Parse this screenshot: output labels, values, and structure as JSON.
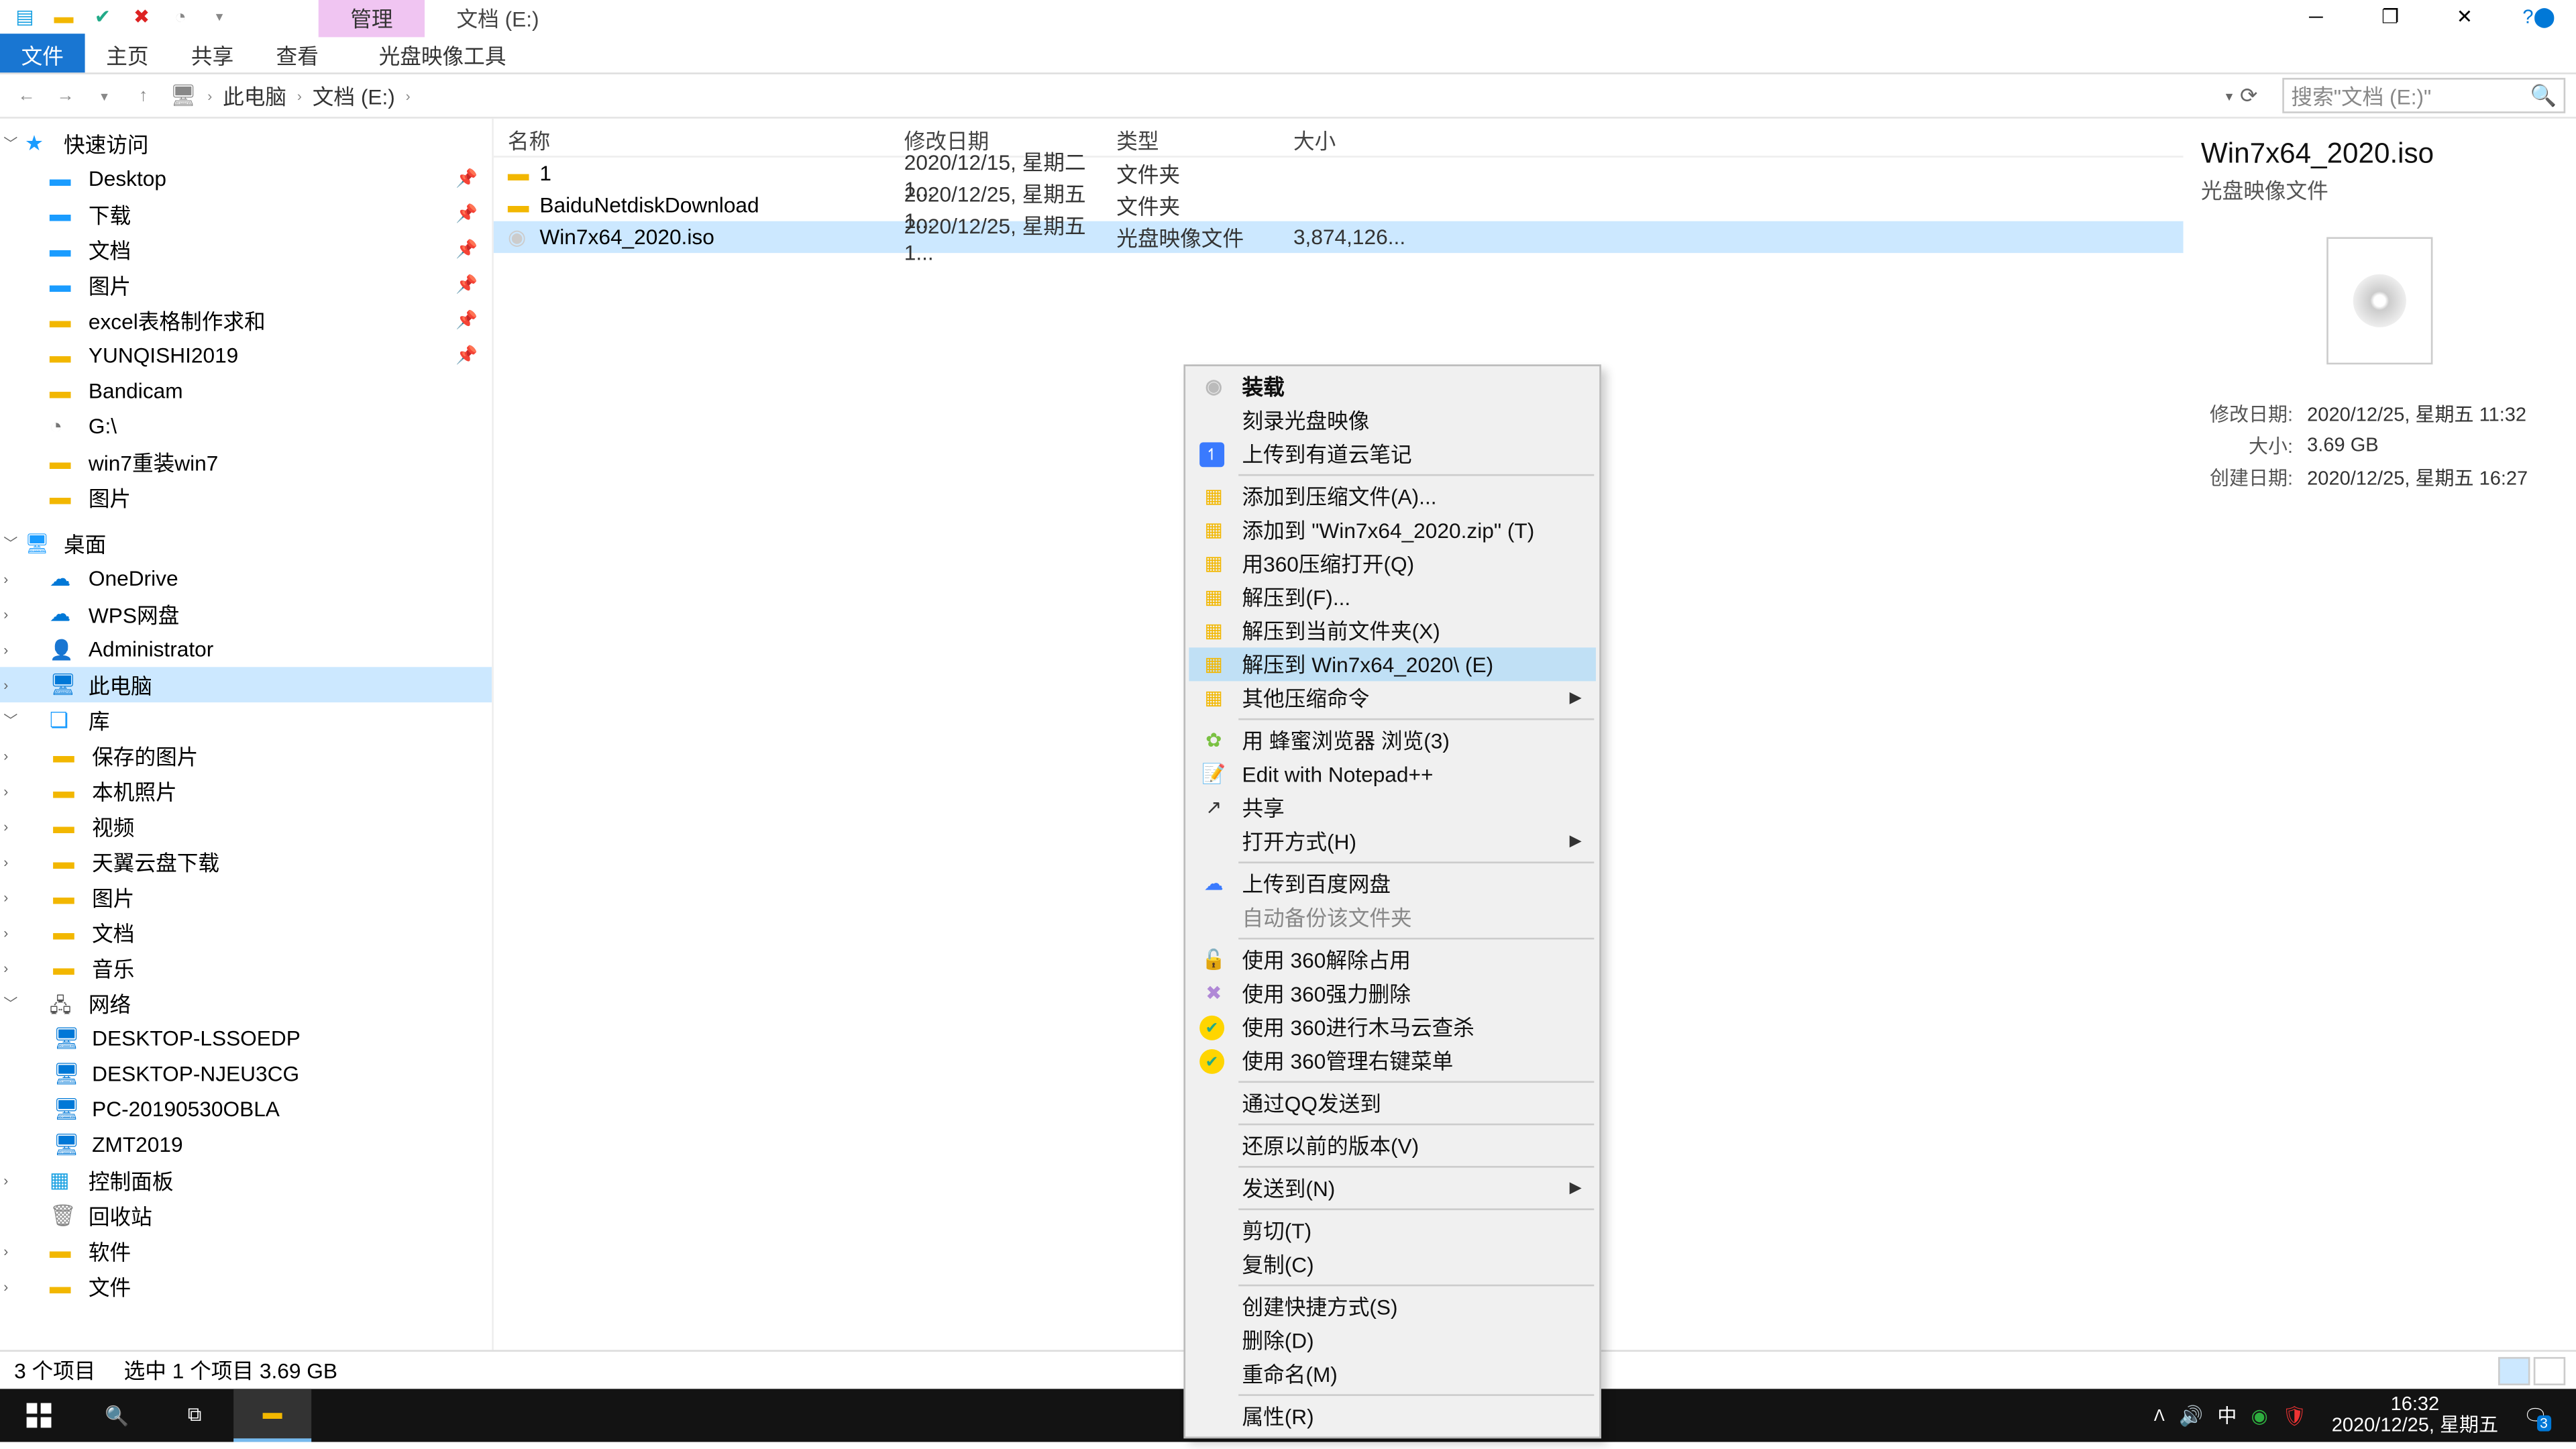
{
  "title": {
    "manage_tab": "管理",
    "location_tab": "文档 (E:)"
  },
  "ribbon": {
    "file": "文件",
    "home": "主页",
    "share": "共享",
    "view": "查看",
    "disc_tools": "光盘映像工具"
  },
  "nav": {
    "crumb1": "此电脑",
    "crumb2": "文档 (E:)",
    "search_placeholder": "搜索\"文档 (E:)\""
  },
  "headers": {
    "name": "名称",
    "date": "修改日期",
    "type": "类型",
    "size": "大小"
  },
  "rows": [
    {
      "name": "1",
      "date": "2020/12/15, 星期二 1...",
      "type": "文件夹",
      "size": ""
    },
    {
      "name": "BaiduNetdiskDownload",
      "date": "2020/12/25, 星期五 1...",
      "type": "文件夹",
      "size": ""
    },
    {
      "name": "Win7x64_2020.iso",
      "date": "2020/12/25, 星期五 1...",
      "type": "光盘映像文件",
      "size": "3,874,126..."
    }
  ],
  "tree": {
    "quick": "快速访问",
    "desktop": "Desktop",
    "downloads": "下载",
    "documents": "文档",
    "pictures": "图片",
    "excel": "excel表格制作求和",
    "yunqishi": "YUNQISHI2019",
    "bandicam": "Bandicam",
    "gdrive": "G:\\",
    "win7reinstall": "win7重装win7",
    "pictures2": "图片",
    "desktop2": "桌面",
    "onedrive": "OneDrive",
    "wps": "WPS网盘",
    "admin": "Administrator",
    "thispc": "此电脑",
    "library": "库",
    "saved_pics": "保存的图片",
    "local_pics": "本机照片",
    "videos": "视频",
    "tianyi": "天翼云盘下载",
    "pictures3": "图片",
    "docs3": "文档",
    "music": "音乐",
    "network": "网络",
    "pc1": "DESKTOP-LSSOEDP",
    "pc2": "DESKTOP-NJEU3CG",
    "pc3": "PC-20190530OBLA",
    "pc4": "ZMT2019",
    "controlpanel": "控制面板",
    "recycle": "回收站",
    "software": "软件",
    "files_folder": "文件"
  },
  "ctx": {
    "mount": "装载",
    "burn": "刻录光盘映像",
    "youdao": "上传到有道云笔记",
    "add_archive": "添加到压缩文件(A)...",
    "add_zip": "添加到 \"Win7x64_2020.zip\" (T)",
    "open_360zip": "用360压缩打开(Q)",
    "extract_to": "解压到(F)...",
    "extract_here": "解压到当前文件夹(X)",
    "extract_named": "解压到 Win7x64_2020\\ (E)",
    "other_zip": "其他压缩命令",
    "bee_browser": "用 蜂蜜浏览器 浏览(3)",
    "notepad": "Edit with Notepad++",
    "share": "共享",
    "open_with": "打开方式(H)",
    "baidu_upload": "上传到百度网盘",
    "auto_backup": "自动备份该文件夹",
    "unlock360": "使用 360解除占用",
    "force_del360": "使用 360强力删除",
    "trojan360": "使用 360进行木马云查杀",
    "manage360": "使用 360管理右键菜单",
    "qq_send": "通过QQ发送到",
    "restore": "还原以前的版本(V)",
    "send_to": "发送到(N)",
    "cut": "剪切(T)",
    "copy": "复制(C)",
    "shortcut": "创建快捷方式(S)",
    "delete": "删除(D)",
    "rename": "重命名(M)",
    "properties": "属性(R)"
  },
  "details": {
    "filename": "Win7x64_2020.iso",
    "filetype": "光盘映像文件",
    "mod_label": "修改日期:",
    "mod_value": "2020/12/25, 星期五 11:32",
    "size_label": "大小:",
    "size_value": "3.69 GB",
    "create_label": "创建日期:",
    "create_value": "2020/12/25, 星期五 16:27"
  },
  "status": {
    "items": "3 个项目",
    "selected": "选中 1 个项目  3.69 GB"
  },
  "taskbar": {
    "ime": "中",
    "time": "16:32",
    "date": "2020/12/25, 星期五",
    "badge": "3"
  }
}
